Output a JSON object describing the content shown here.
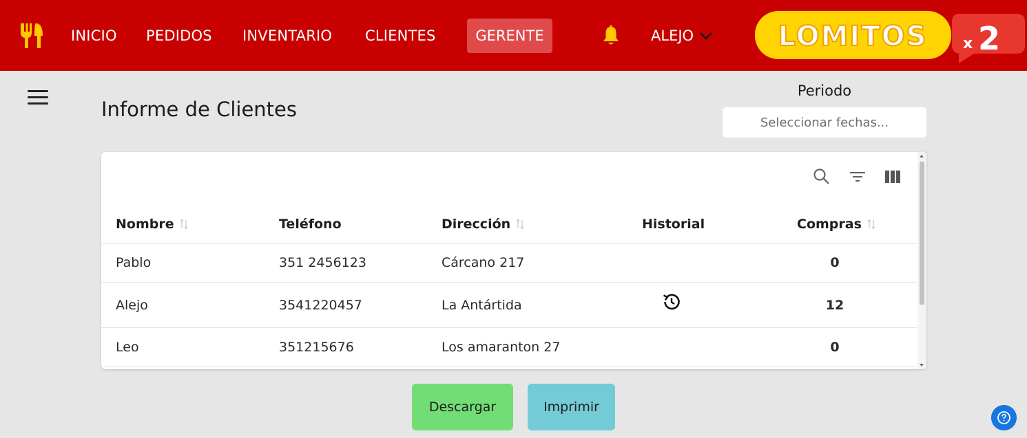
{
  "nav": {
    "items": [
      "INICIO",
      "PEDIDOS",
      "INVENTARIO",
      "CLIENTES"
    ],
    "active": "GERENTE",
    "user": "ALEJO"
  },
  "brand": {
    "text": "LOMITOS",
    "badge": "x2",
    "colors": {
      "yellow": "#ffd400",
      "red": "#e8372f"
    }
  },
  "page": {
    "title": "Informe de Clientes",
    "period_label": "Periodo",
    "date_placeholder": "Seleccionar fechas..."
  },
  "table": {
    "columns": [
      "Nombre",
      "Teléfono",
      "Dirección",
      "Historial",
      "Compras"
    ],
    "rows": [
      {
        "nombre": "Pablo",
        "telefono": "351 2456123",
        "direccion": "Cárcano 217",
        "historial": false,
        "compras": "0"
      },
      {
        "nombre": "Alejo",
        "telefono": "3541220457",
        "direccion": "La Antártida",
        "historial": true,
        "compras": "12"
      },
      {
        "nombre": "Leo",
        "telefono": "351215676",
        "direccion": "Los amaranton 27",
        "historial": false,
        "compras": "0"
      }
    ],
    "toolbar_icons": [
      "search-icon",
      "filter-icon",
      "columns-icon"
    ]
  },
  "actions": {
    "download": "Descargar",
    "print": "Imprimir"
  },
  "colors": {
    "navbar": "#c80000",
    "active_tab": "#e04a4a",
    "download": "#72dd74",
    "print": "#73cbd6",
    "help": "#1677e0"
  }
}
